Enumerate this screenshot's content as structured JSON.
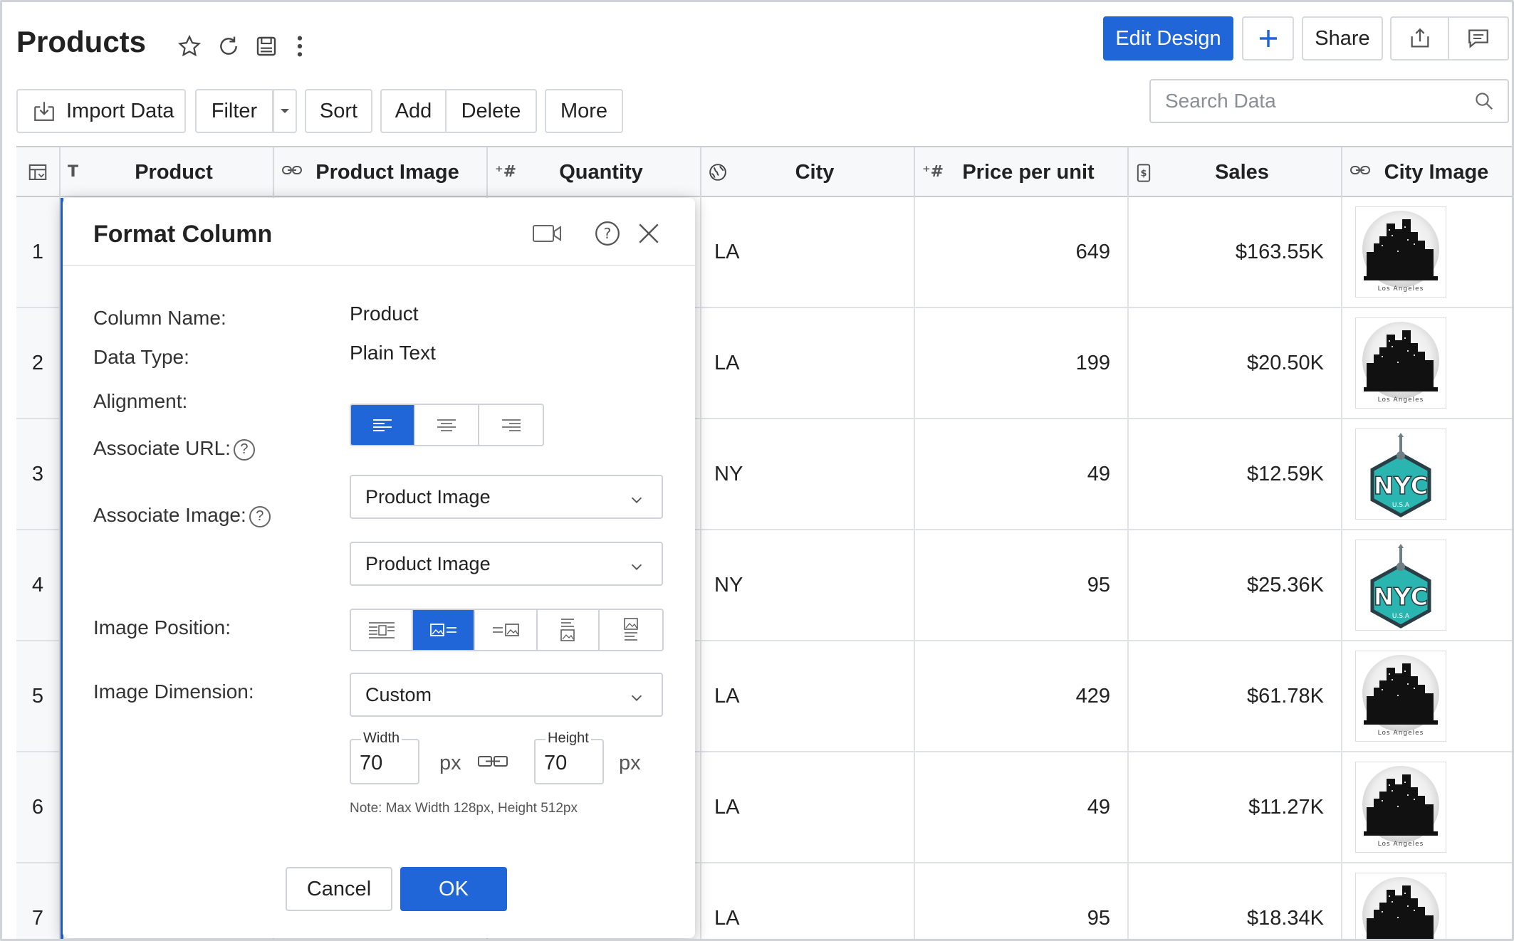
{
  "page": {
    "title": "Products"
  },
  "top_buttons": {
    "edit_design": "Edit Design",
    "share": "Share"
  },
  "search": {
    "placeholder": "Search Data"
  },
  "toolbar": {
    "import": "Import Data",
    "filter": "Filter",
    "sort": "Sort",
    "add": "Add",
    "delete": "Delete",
    "more": "More"
  },
  "columns": [
    {
      "key": "product",
      "label": "Product",
      "type_icon": "T"
    },
    {
      "key": "product_image",
      "label": "Product Image",
      "type_icon": "link-icon"
    },
    {
      "key": "quantity",
      "label": "Quantity",
      "type_icon": "+#"
    },
    {
      "key": "city",
      "label": "City",
      "type_icon": "globe-icon"
    },
    {
      "key": "price",
      "label": "Price per unit",
      "type_icon": "+#"
    },
    {
      "key": "sales",
      "label": "Sales",
      "type_icon": "currency-icon"
    },
    {
      "key": "city_image",
      "label": "City Image",
      "type_icon": "link-icon"
    }
  ],
  "rows": [
    {
      "n": "1",
      "city": "LA",
      "price": "649",
      "sales": "$163.55K",
      "img": "los-angeles"
    },
    {
      "n": "2",
      "city": "LA",
      "price": "199",
      "sales": "$20.50K",
      "img": "los-angeles"
    },
    {
      "n": "3",
      "city": "NY",
      "price": "49",
      "sales": "$12.59K",
      "img": "nyc"
    },
    {
      "n": "4",
      "city": "NY",
      "price": "95",
      "sales": "$25.36K",
      "img": "nyc"
    },
    {
      "n": "5",
      "city": "LA",
      "price": "429",
      "sales": "$61.78K",
      "img": "los-angeles"
    },
    {
      "n": "6",
      "city": "LA",
      "price": "49",
      "sales": "$11.27K",
      "img": "los-angeles"
    },
    {
      "n": "7",
      "city": "LA",
      "price": "95",
      "sales": "$18.34K",
      "img": "los-angeles"
    }
  ],
  "dialog": {
    "title": "Format Column",
    "column_name_label": "Column Name:",
    "column_name": "Product",
    "data_type_label": "Data Type:",
    "data_type": "Plain Text",
    "alignment_label": "Alignment:",
    "alignment_selected": "left",
    "assoc_url_label": "Associate URL:",
    "assoc_url": "Product Image",
    "assoc_image_label": "Associate Image:",
    "assoc_image": "Product Image",
    "image_position_label": "Image Position:",
    "image_position_selected": 1,
    "image_dimension_label": "Image Dimension:",
    "image_dimension": "Custom",
    "width_label": "Width",
    "width": "70",
    "height_label": "Height",
    "height": "70",
    "unit": "px",
    "note": "Note: Max Width 128px, Height 512px",
    "cancel": "Cancel",
    "ok": "OK"
  },
  "thumb_text": {
    "los-angeles": "Los Angeles",
    "nyc": "NYC",
    "nyc_sub": "U.S.A"
  },
  "colors": {
    "accent": "#2166d8",
    "nyc_teal": "#2bb5b0"
  }
}
